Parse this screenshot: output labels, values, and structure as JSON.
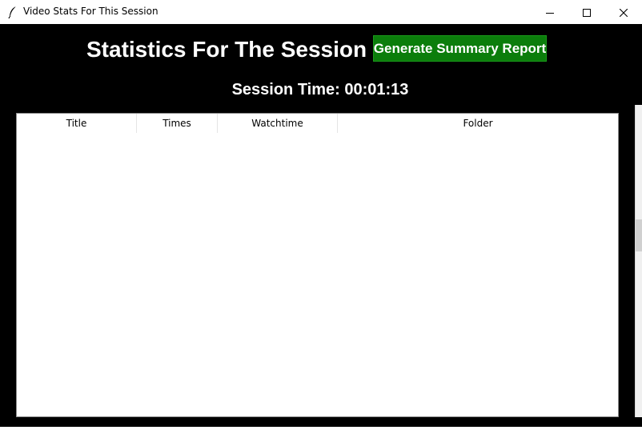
{
  "window": {
    "title": "Video Stats For This Session"
  },
  "header": {
    "heading": "Statistics For The Session",
    "report_button_label": "Generate Summary Report",
    "session_time": "Session Time: 00:01:13"
  },
  "table": {
    "columns": [
      "Title",
      "Times",
      "Watchtime",
      "Folder"
    ],
    "rows": []
  },
  "colors": {
    "background": "#000000",
    "button_bg": "#0b7d0b",
    "text": "#ffffff",
    "table_bg": "#ffffff"
  },
  "icons": {
    "app": "feather-icon",
    "minimize": "minimize-icon",
    "maximize": "maximize-icon",
    "close": "close-icon"
  }
}
